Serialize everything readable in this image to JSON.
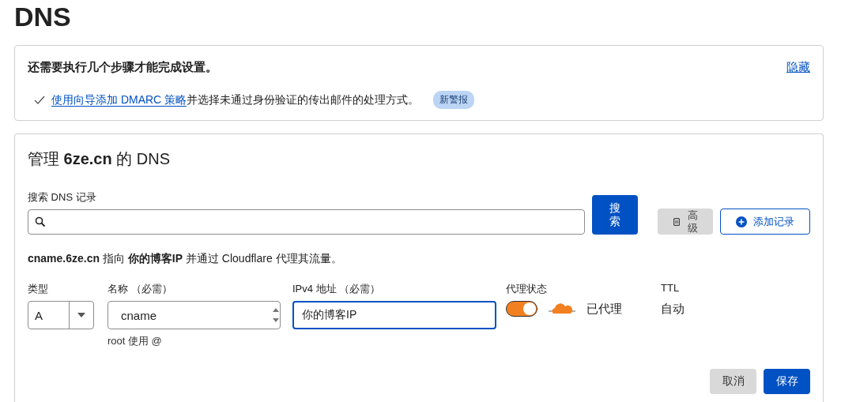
{
  "page_title": "DNS",
  "setup": {
    "heading": "还需要执行几个步骤才能完成设置。",
    "hide_link": "隐藏",
    "steps": [
      {
        "done": true,
        "link": "使用向导添加 DMARC 策略",
        "text": "并选择未通过身份验证的传出邮件的处理方式。",
        "badge": "新警报"
      }
    ]
  },
  "manage": {
    "title": "管理 **6ze.cn** 的 DNS",
    "search": {
      "label": "搜索 DNS 记录",
      "button": "搜索"
    },
    "advanced_button": "高级",
    "add_button": "添加记录",
    "info": "**cname.6ze.cn** 指向 **你的博客IP** 并通过 Cloudflare 代理其流量。",
    "form": {
      "type": {
        "label": "类型",
        "value": "A"
      },
      "name": {
        "label": "名称 （必需）",
        "value": "cname",
        "hint": "root 使用 @"
      },
      "ipv4": {
        "label": "IPv4 地址 （必需）",
        "value": "你的博客IP",
        "focused": true
      },
      "proxy": {
        "label": "代理状态",
        "on": true,
        "status": "已代理"
      },
      "ttl": {
        "label": "TTL",
        "value": "自动"
      }
    },
    "cancel": "取消",
    "save": "保存"
  }
}
